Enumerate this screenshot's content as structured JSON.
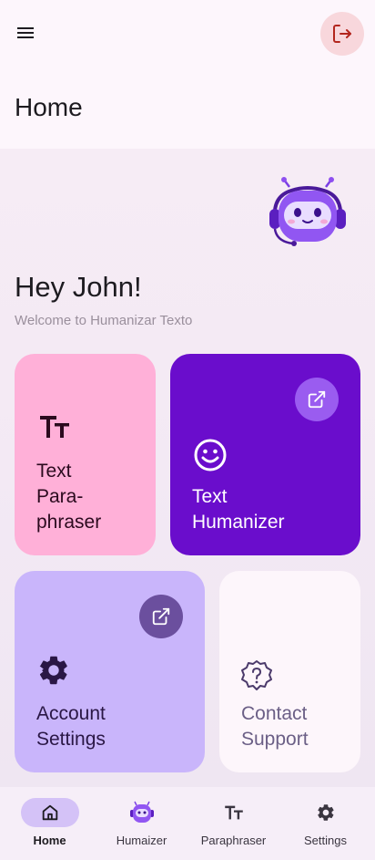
{
  "header": {
    "title": "Home",
    "menu_icon": "hamburger-menu-icon",
    "logout_icon": "logout-icon",
    "logout_bg": "#f8d7dc",
    "logout_color": "#b3261e"
  },
  "hero": {
    "greeting": "Hey John!",
    "welcome": "Welcome to Humanizar Texto",
    "mascot_icon": "robot-mascot-icon"
  },
  "cards": {
    "paraphraser": {
      "line1": "Text",
      "line2": "Para-",
      "line3": "phraser",
      "icon": "text-size-icon",
      "bg": "#ffb0d8"
    },
    "humanizer": {
      "line1": "Text",
      "line2": "Humanizer",
      "icon": "smiley-face-icon",
      "bg": "#6a0dcc"
    },
    "account": {
      "line1": "Account",
      "line2": "Settings",
      "icon": "gear-icon",
      "bg": "#c9b5fb"
    },
    "support": {
      "line1": "Contact",
      "line2": "Support",
      "icon": "help-badge-icon",
      "bg": "#fdf6fb"
    }
  },
  "nav": {
    "items": [
      {
        "label": "Home",
        "icon": "home-icon",
        "active": true
      },
      {
        "label": "Humaizer",
        "icon": "robot-icon",
        "active": false
      },
      {
        "label": "Paraphraser",
        "icon": "text-size-icon",
        "active": false
      },
      {
        "label": "Settings",
        "icon": "gear-icon",
        "active": false
      }
    ],
    "active_pill_color": "#d4c2f7"
  }
}
